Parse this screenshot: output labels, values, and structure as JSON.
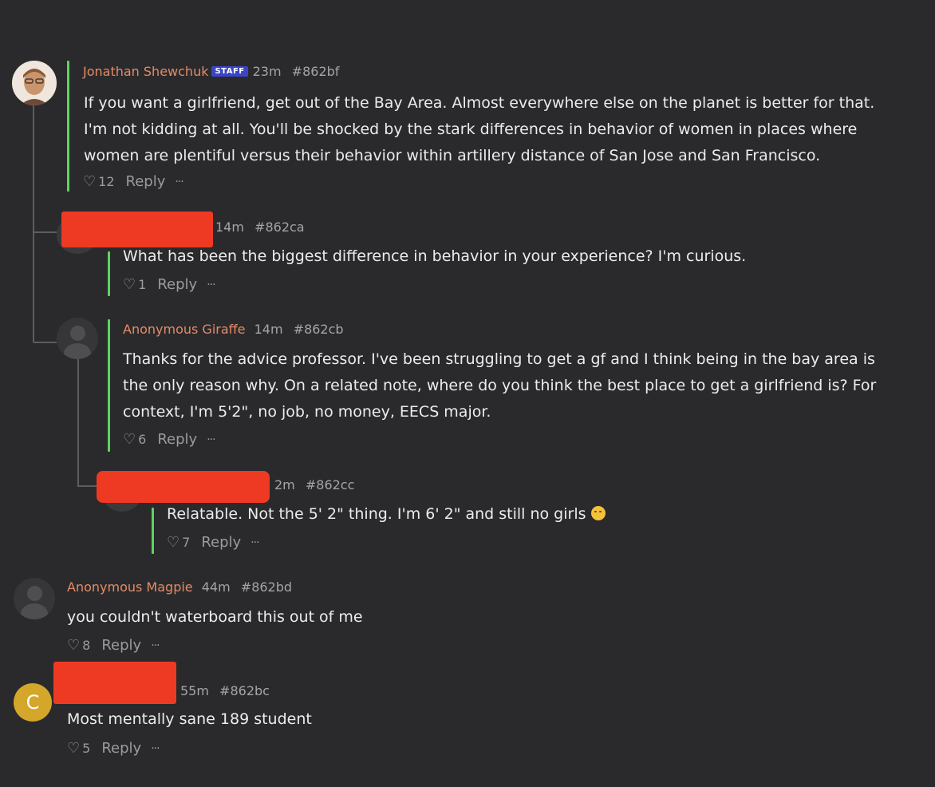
{
  "accent_colors": {
    "author": "#e58b67",
    "staff_badge": "#3b45c9",
    "reply_bar": "#5fd35f",
    "redaction": "#ef3a23",
    "avatar_letter_bg": "#d4a72a"
  },
  "comments": [
    {
      "author": "Jonathan Shewchuk",
      "badge": "STAFF",
      "time": "23m",
      "id": "#862bf",
      "lines": [
        "If you want a girlfriend, get out of the Bay Area. Almost everywhere else on the planet is better for that.",
        "I'm not kidding at all. You'll be shocked by the stark differences in behavior of women in places where",
        "women are plentiful versus their behavior within artillery distance of San Jose and San Francisco."
      ],
      "likes": "12",
      "reply_label": "Reply",
      "more_label": "···",
      "avatar": "photo"
    },
    {
      "author": "",
      "time": "14m",
      "id": "#862ca",
      "lines": [
        "What has been the biggest difference in behavior in your experience? I'm curious."
      ],
      "likes": "1",
      "reply_label": "Reply",
      "more_label": "···"
    },
    {
      "author": "Anonymous Giraffe",
      "time": "14m",
      "id": "#862cb",
      "lines": [
        "Thanks for the advice professor. I've been struggling to get a gf and I think being in the bay area is",
        "the only reason why. On a related note, where do you think the best place to get a girlfriend is? For",
        "context, I'm 5'2\", no job, no money, EECS major."
      ],
      "likes": "6",
      "reply_label": "Reply",
      "more_label": "···"
    },
    {
      "author": "",
      "time": "2m",
      "id": "#862cc",
      "lines": [
        "Relatable. Not the 5' 2\" thing. I'm 6' 2\" and still no girls"
      ],
      "emoji": "grimacing-face",
      "likes": "7",
      "reply_label": "Reply",
      "more_label": "···"
    },
    {
      "author": "Anonymous Magpie",
      "time": "44m",
      "id": "#862bd",
      "lines": [
        "you couldn't waterboard this out of me"
      ],
      "likes": "8",
      "reply_label": "Reply",
      "more_label": "···"
    },
    {
      "author": "",
      "avatar_letter": "C",
      "time": "55m",
      "id": "#862bc",
      "lines": [
        "Most mentally sane 189 student"
      ],
      "likes": "5",
      "reply_label": "Reply",
      "more_label": "···"
    }
  ]
}
